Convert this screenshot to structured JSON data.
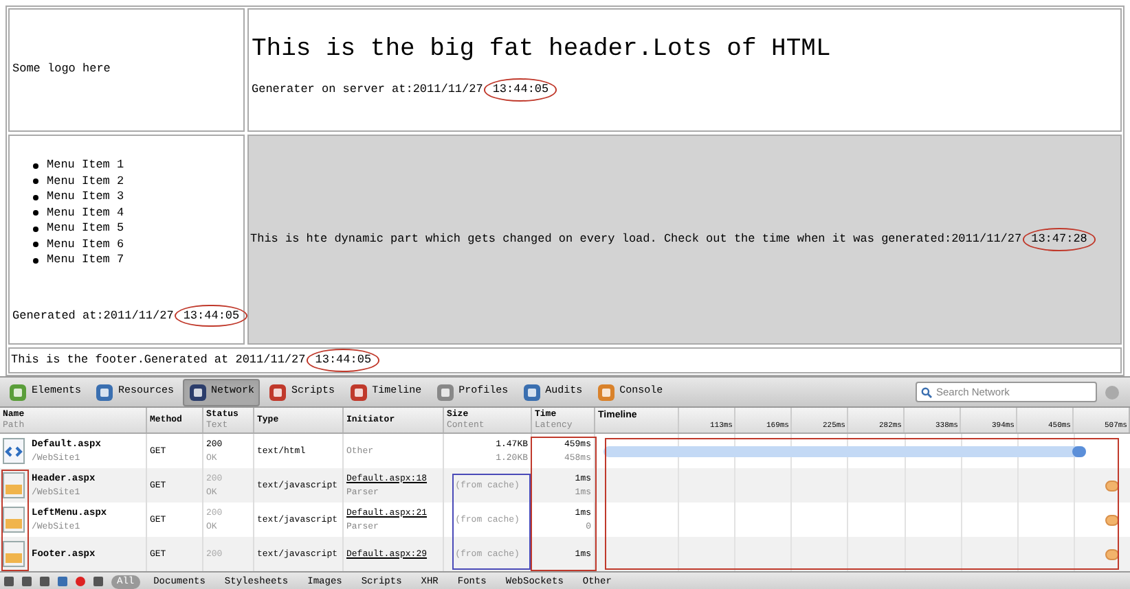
{
  "page": {
    "logo_text": "Some logo here",
    "header": {
      "title": "This is the big fat header.Lots of HTML",
      "generated_label": "Generater on server at:2011/11/27",
      "generated_time": "13:44:05"
    },
    "menu": [
      "Menu Item 1",
      "Menu Item 2",
      "Menu Item 3",
      "Menu Item 4",
      "Menu Item 5",
      "Menu Item 6",
      "Menu Item 7"
    ],
    "left_generated": {
      "label": "Generated at:2011/11/27",
      "time": "13:44:05"
    },
    "dynamic": {
      "label": "This is hte dynamic part which gets changed on every load. Check out the time when it was generated:2011/11/27",
      "time": "13:47:28"
    },
    "footer": {
      "label": "This is the footer.Generated at 2011/11/27",
      "time": "13:44:05"
    }
  },
  "devtools": {
    "tabs": [
      {
        "label": "Elements",
        "selected": false
      },
      {
        "label": "Resources",
        "selected": false
      },
      {
        "label": "Network",
        "selected": true
      },
      {
        "label": "Scripts",
        "selected": false
      },
      {
        "label": "Timeline",
        "selected": false
      },
      {
        "label": "Profiles",
        "selected": false
      },
      {
        "label": "Audits",
        "selected": false
      },
      {
        "label": "Console",
        "selected": false
      }
    ],
    "search": {
      "placeholder": "Search Network"
    },
    "columns": [
      {
        "title": "Name",
        "subtitle": "Path"
      },
      {
        "title": "Method"
      },
      {
        "title": "Status",
        "subtitle": "Text"
      },
      {
        "title": "Type"
      },
      {
        "title": "Initiator"
      },
      {
        "title": "Size",
        "subtitle": "Content"
      },
      {
        "title": "Time",
        "subtitle": "Latency"
      },
      {
        "title": "Timeline"
      }
    ],
    "timeline_ticks": [
      "113ms",
      "169ms",
      "225ms",
      "282ms",
      "338ms",
      "394ms",
      "450ms",
      "507ms"
    ],
    "rows": [
      {
        "kind": "document",
        "name": "Default.aspx",
        "path": "/WebSite1",
        "method": "GET",
        "status": "200",
        "status_text": "OK",
        "type": "text/html",
        "initiator": "Other",
        "size": "1.47KB",
        "content": "1.20KB",
        "time": "459ms",
        "latency": "458ms"
      },
      {
        "kind": "script",
        "name": "Header.aspx",
        "path": "/WebSite1",
        "method": "GET",
        "status": "200",
        "status_text": "OK",
        "type": "text/javascript",
        "initiator": "Default.aspx:18",
        "initiator_detail": "Parser",
        "size": "(from cache)",
        "time": "1ms",
        "latency": "1ms"
      },
      {
        "kind": "script",
        "name": "LeftMenu.aspx",
        "path": "/WebSite1",
        "method": "GET",
        "status": "200",
        "status_text": "OK",
        "type": "text/javascript",
        "initiator": "Default.aspx:21",
        "initiator_detail": "Parser",
        "size": "(from cache)",
        "time": "1ms",
        "latency": "0"
      },
      {
        "kind": "script",
        "name": "Footer.aspx",
        "method": "GET",
        "status": "200",
        "type": "text/javascript",
        "initiator": "Default.aspx:29",
        "size": "(from cache)",
        "time": "1ms"
      }
    ],
    "filters": [
      {
        "label": "All",
        "selected": true
      },
      {
        "label": "Documents",
        "selected": false
      },
      {
        "label": "Stylesheets",
        "selected": false
      },
      {
        "label": "Images",
        "selected": false
      },
      {
        "label": "Scripts",
        "selected": false
      },
      {
        "label": "XHR",
        "selected": false
      },
      {
        "label": "Fonts",
        "selected": false
      },
      {
        "label": "WebSockets",
        "selected": false
      },
      {
        "label": "Other",
        "selected": false
      }
    ]
  }
}
